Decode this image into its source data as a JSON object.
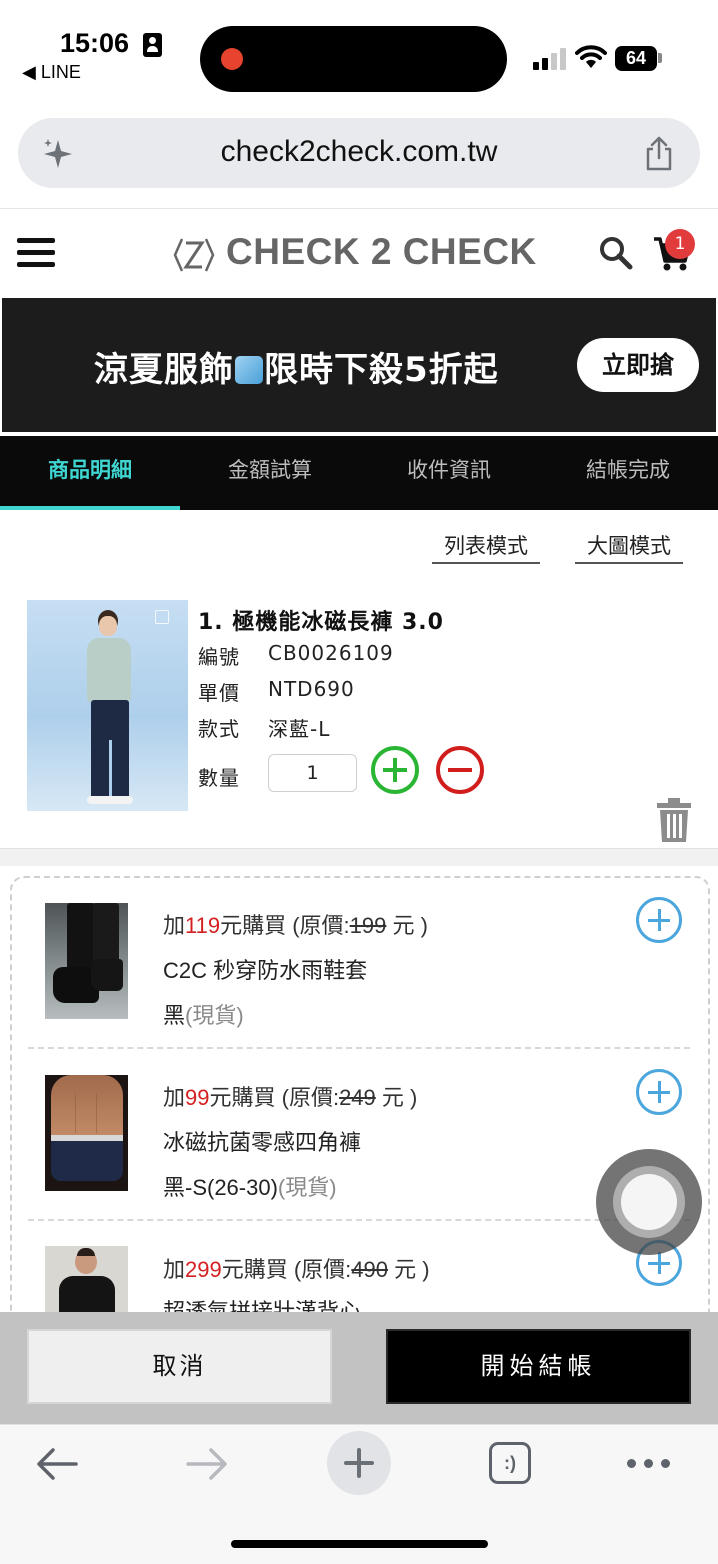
{
  "status_bar": {
    "time": "15:06",
    "back_app": "◀ LINE",
    "battery": "64"
  },
  "browser": {
    "url": "check2check.com.tw",
    "tabs_icon_label": ":)"
  },
  "site": {
    "logo": "CHECK 2 CHECK",
    "cart_count": "1"
  },
  "banner": {
    "text_before": "涼夏服飾",
    "text_after": "限時下殺5折起",
    "button": "立即搶"
  },
  "steps": [
    {
      "label": "商品明細",
      "active": true
    },
    {
      "label": "金額試算",
      "active": false
    },
    {
      "label": "收件資訊",
      "active": false
    },
    {
      "label": "結帳完成",
      "active": false
    }
  ],
  "view_modes": {
    "list": "列表模式",
    "large": "大圖模式"
  },
  "cart_item": {
    "title": "1. 極機能冰磁長褲 3.0",
    "code_label": "編號",
    "code": "CB0026109",
    "price_label": "單價",
    "price": "NTD690",
    "style_label": "款式",
    "style": "深藍-L",
    "qty_label": "數量",
    "qty": "1"
  },
  "addons": [
    {
      "prefix": "加",
      "price": "119",
      "mid": "元購買 (原價:",
      "orig": "199",
      "suffix": " 元 )",
      "name": "C2C 秒穿防水雨鞋套",
      "variant": "黑",
      "stock": "(現貨)"
    },
    {
      "prefix": "加",
      "price": "99",
      "mid": "元購買 (原價:",
      "orig": "249",
      "suffix": " 元 )",
      "name": "冰磁抗菌零感四角褲",
      "variant": "黑-S(26-30)",
      "stock": "(現貨)"
    },
    {
      "prefix": "加",
      "price": "299",
      "mid": "元購買 (原價:",
      "orig": "490",
      "suffix": " 元 )",
      "name": "超透氣拼接壯漢背心"
    }
  ],
  "actions": {
    "cancel": "取消",
    "checkout": "開始結帳"
  },
  "colors": {
    "accent": "#3fd6d2",
    "price_red": "#d42020",
    "plus_green": "#2bb534",
    "minus_red": "#d21d1d",
    "addon_blue": "#4aa6dc"
  }
}
